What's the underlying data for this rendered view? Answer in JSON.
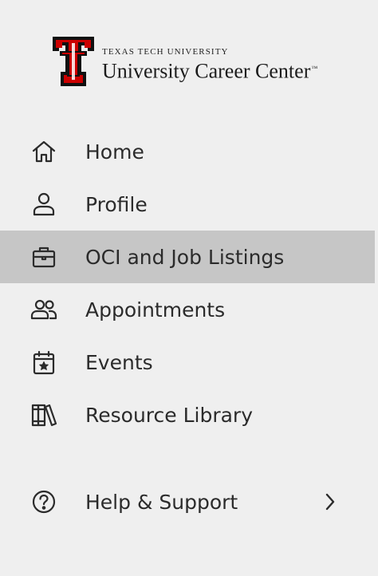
{
  "logo": {
    "line1": "TEXAS TECH UNIVERSITY",
    "line2": "University Career Center",
    "trademark": "™",
    "mark_letters": "TT",
    "mark_color": "#cc0000"
  },
  "nav": {
    "items": [
      {
        "label": "Home",
        "icon": "home-icon",
        "active": false
      },
      {
        "label": "Profile",
        "icon": "user-icon",
        "active": false
      },
      {
        "label": "OCI and Job Listings",
        "icon": "briefcase-icon",
        "active": true
      },
      {
        "label": "Appointments",
        "icon": "users-icon",
        "active": false
      },
      {
        "label": "Events",
        "icon": "calendar-star-icon",
        "active": false
      },
      {
        "label": "Resource Library",
        "icon": "books-icon",
        "active": false
      }
    ],
    "help": {
      "label": "Help & Support",
      "icon": "question-circle-icon",
      "trailing_icon": "chevron-right-icon"
    }
  },
  "colors": {
    "background": "#efefef",
    "active_background": "#c6c6c6",
    "text": "#2b2b2b",
    "brand_red": "#cc0000"
  }
}
